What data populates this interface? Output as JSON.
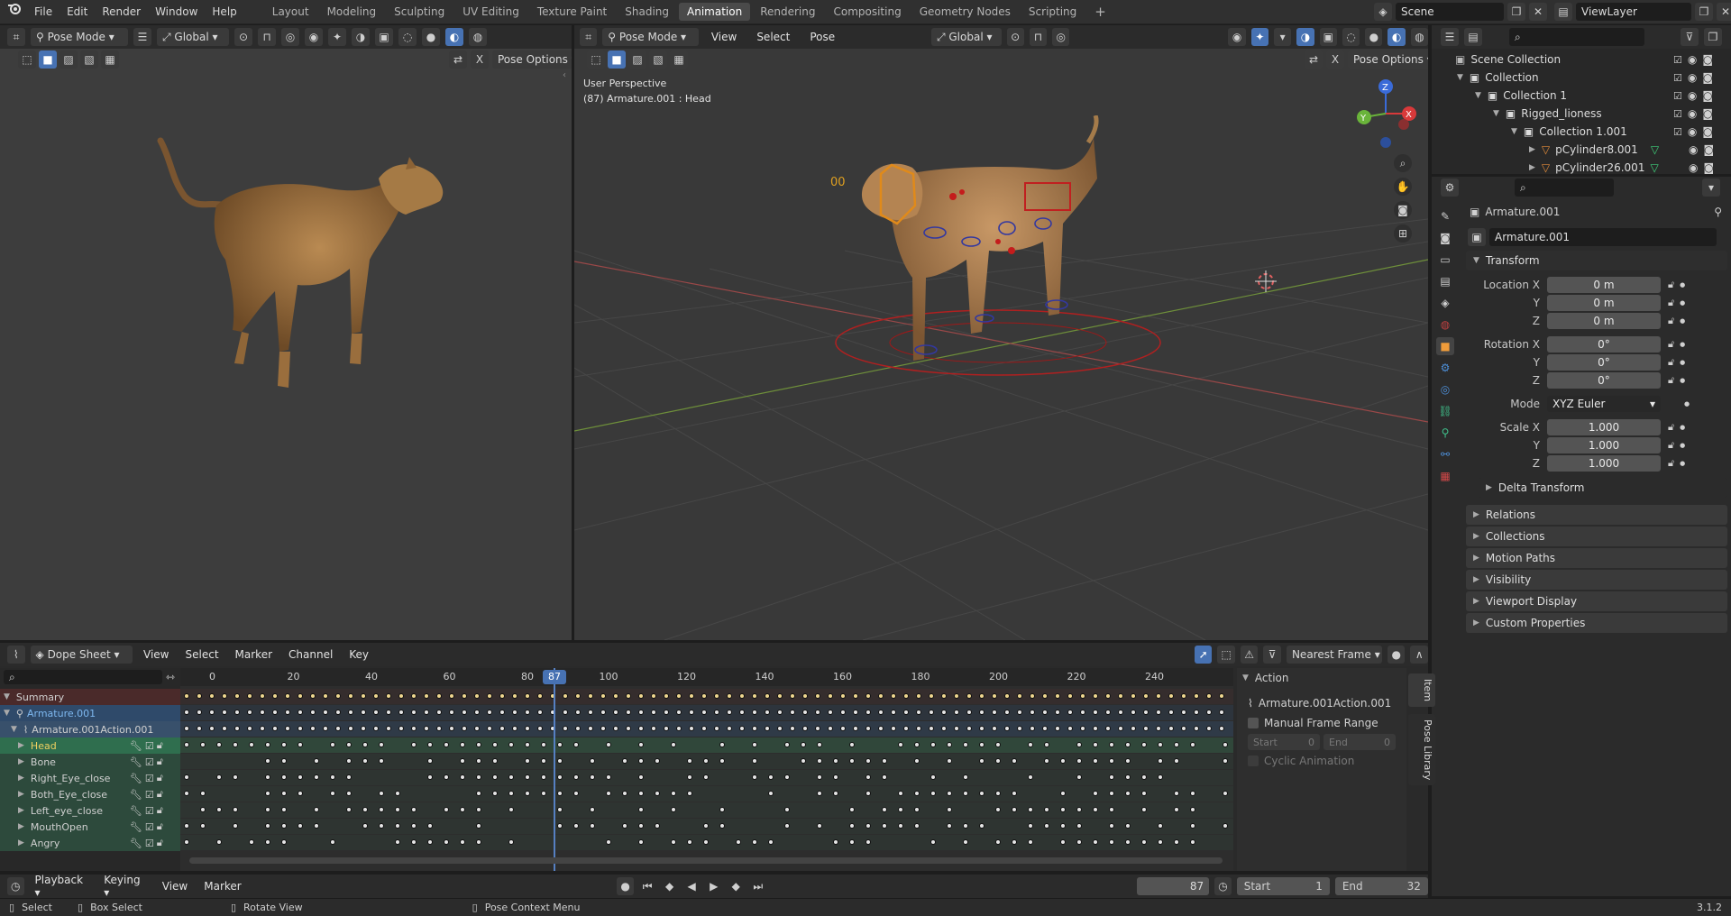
{
  "menubar": {
    "menus": [
      "File",
      "Edit",
      "Render",
      "Window",
      "Help"
    ],
    "workspaces": [
      "Layout",
      "Modeling",
      "Sculpting",
      "UV Editing",
      "Texture Paint",
      "Shading",
      "Animation",
      "Rendering",
      "Compositing",
      "Geometry Nodes",
      "Scripting"
    ],
    "active_workspace": "Animation",
    "add_symbol": "+",
    "scene": "Scene",
    "view_layer": "ViewLayer"
  },
  "left_viewport": {
    "mode": "Pose Mode",
    "orientation": "Global",
    "pose_options": "Pose Options",
    "x_label": "X"
  },
  "main_viewport": {
    "mode": "Pose Mode",
    "menus": [
      "View",
      "Select",
      "Pose"
    ],
    "orientation": "Global",
    "pose_options": "Pose Options",
    "x_label": "X",
    "overlay_line1": "User Perspective",
    "overlay_line2": "(87) Armature.001 : Head",
    "gizmo": {
      "x": "X",
      "y": "Y",
      "z": "Z"
    }
  },
  "outliner": {
    "search_placeholder": "",
    "items": [
      {
        "label": "Scene Collection"
      },
      {
        "label": "Collection"
      },
      {
        "label": "Collection 1"
      },
      {
        "label": "Rigged_lioness"
      },
      {
        "label": "Collection 1.001"
      },
      {
        "label": "pCylinder8.001"
      },
      {
        "label": "pCylinder26.001"
      }
    ]
  },
  "properties": {
    "object_name": "Armature.001",
    "datablock": "Armature.001",
    "transform_label": "Transform",
    "location_label": "Location X",
    "rotation_label": "Rotation X",
    "scale_label": "Scale X",
    "axis_y": "Y",
    "axis_z": "Z",
    "location": [
      "0 m",
      "0 m",
      "0 m"
    ],
    "rotation": [
      "0°",
      "0°",
      "0°"
    ],
    "mode_label": "Mode",
    "mode_value": "XYZ Euler",
    "scale": [
      "1.000",
      "1.000",
      "1.000"
    ],
    "delta_transform": "Delta Transform",
    "panels": [
      "Relations",
      "Collections",
      "Motion Paths",
      "Visibility",
      "Viewport Display",
      "Custom Properties"
    ]
  },
  "dopesheet": {
    "editor": "Dope Sheet",
    "menus": [
      "View",
      "Select",
      "Marker",
      "Channel",
      "Key"
    ],
    "snapping": "Nearest Frame",
    "frame_ticks": [
      "0",
      "20",
      "40",
      "60",
      "80",
      "100",
      "120",
      "140",
      "160",
      "180",
      "200",
      "220",
      "240"
    ],
    "current_frame": "87",
    "channels": [
      {
        "label": "Summary"
      },
      {
        "label": "Armature.001"
      },
      {
        "label": "Armature.001Action.001"
      },
      {
        "label": "Head"
      },
      {
        "label": "Bone"
      },
      {
        "label": "Right_Eye_close"
      },
      {
        "label": "Both_Eye_close"
      },
      {
        "label": "Left_eye_close"
      },
      {
        "label": "MouthOpen"
      },
      {
        "label": "Angry"
      }
    ],
    "action_panel": {
      "title": "Action",
      "action_name": "Armature.001Action.001",
      "manual_range": "Manual Frame Range",
      "start_label": "Start",
      "start_value": "0",
      "end_label": "End",
      "end_value": "0",
      "cyclic": "Cyclic Animation"
    },
    "side_tabs": [
      "Item",
      "Pose Library"
    ]
  },
  "timeline": {
    "menus": [
      "Playback",
      "Keying",
      "View",
      "Marker"
    ],
    "frame": "87",
    "start_label": "Start",
    "start": "1",
    "end_label": "End",
    "end": "32"
  },
  "statusbar": {
    "select": "Select",
    "box_select": "Box Select",
    "rotate_view": "Rotate View",
    "pose_context": "Pose Context Menu",
    "version": "3.1.2"
  }
}
